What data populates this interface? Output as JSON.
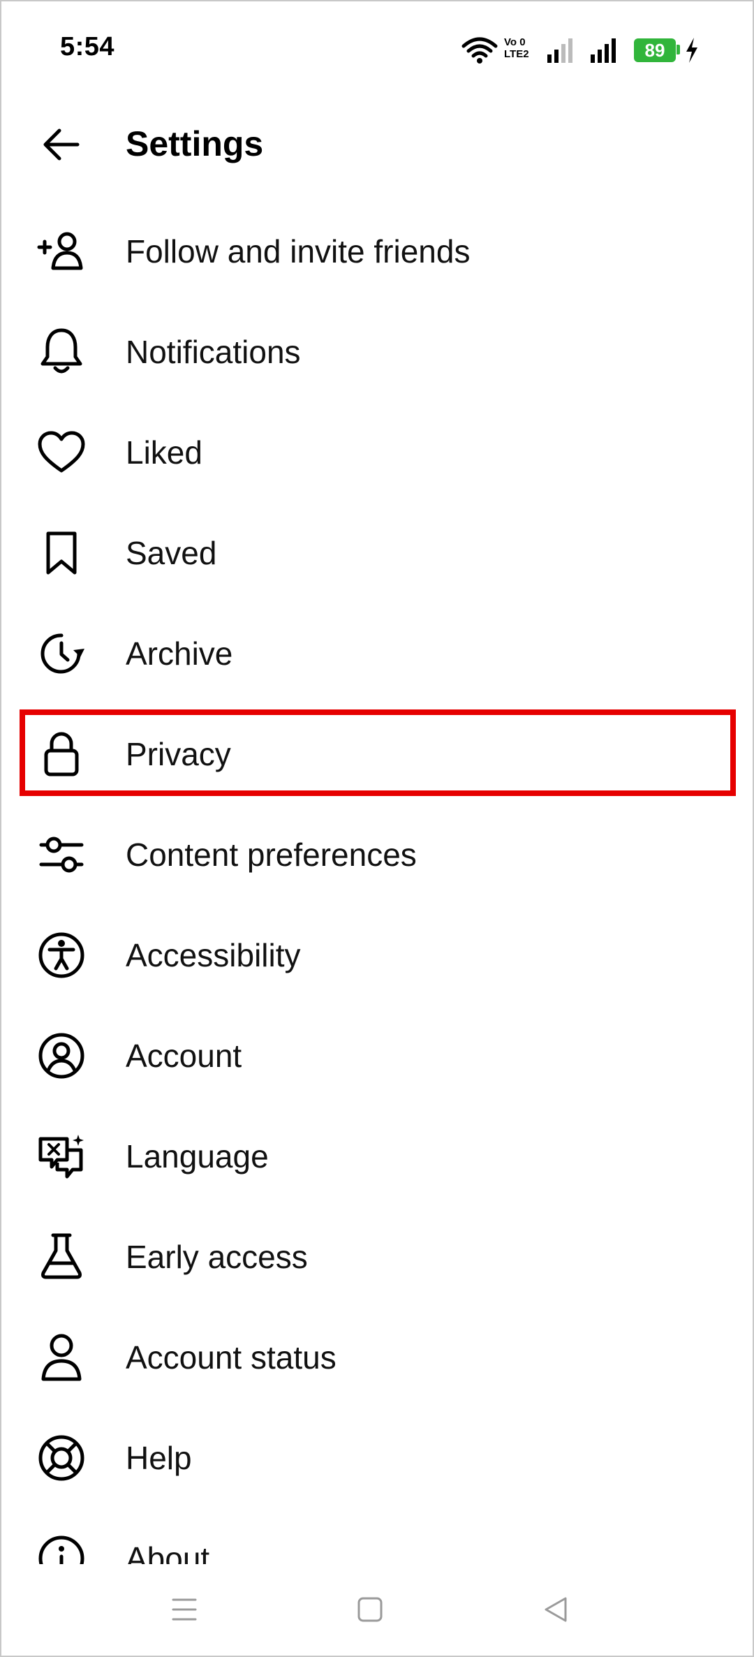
{
  "status_bar": {
    "time": "5:54",
    "volte_top": "Vo 0",
    "volte_bottom": "LTE2",
    "battery": "89",
    "battery_color": "#31b53b"
  },
  "header": {
    "title": "Settings",
    "back_icon": "arrow-left-icon"
  },
  "menu": {
    "items": [
      {
        "label": "Follow and invite friends",
        "icon": "add-person-icon"
      },
      {
        "label": "Notifications",
        "icon": "bell-icon"
      },
      {
        "label": "Liked",
        "icon": "heart-icon"
      },
      {
        "label": "Saved",
        "icon": "bookmark-icon"
      },
      {
        "label": "Archive",
        "icon": "archive-clock-icon"
      },
      {
        "label": "Privacy",
        "icon": "lock-icon"
      },
      {
        "label": "Content preferences",
        "icon": "sliders-icon"
      },
      {
        "label": "Accessibility",
        "icon": "accessibility-icon"
      },
      {
        "label": "Account",
        "icon": "account-circle-icon"
      },
      {
        "label": "Language",
        "icon": "language-icon"
      },
      {
        "label": "Early access",
        "icon": "flask-icon"
      },
      {
        "label": "Account status",
        "icon": "person-icon"
      },
      {
        "label": "Help",
        "icon": "lifebuoy-icon"
      },
      {
        "label": "About",
        "icon": "info-icon"
      }
    ],
    "highlighted_item": "Privacy",
    "highlight_color": "#e60000"
  },
  "nav_bar": {
    "icons": [
      "menu-lines-icon",
      "home-square-icon",
      "back-triangle-icon"
    ]
  }
}
